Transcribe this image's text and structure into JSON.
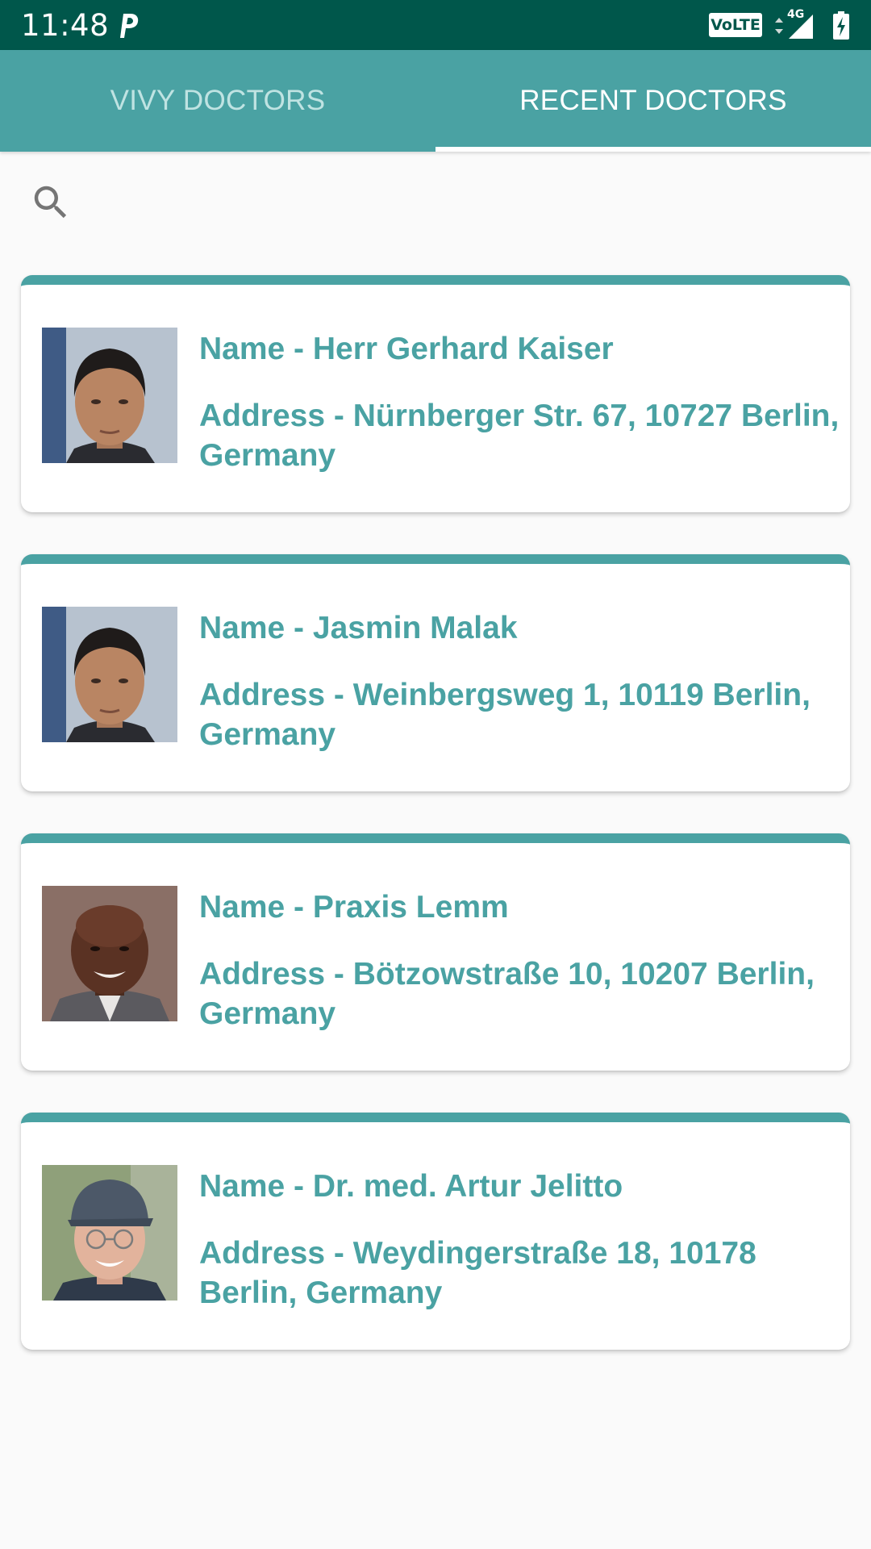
{
  "status_bar": {
    "time": "11:48",
    "volte": "VoLTE",
    "network": "4G",
    "icons": [
      "parking-app-icon",
      "signal-icon",
      "battery-charging-icon"
    ]
  },
  "tabs": [
    {
      "label": "VIVY DOCTORS",
      "selected": false
    },
    {
      "label": "RECENT DOCTORS",
      "selected": true
    }
  ],
  "search": {
    "icon": "search-icon"
  },
  "doctors": [
    {
      "name": "Name - Herr Gerhard Kaiser",
      "address": "Address - Nürnberger Str. 67, 10727 Berlin, Germany",
      "avatar": "man-dark-hair"
    },
    {
      "name": "Name - Jasmin Malak",
      "address": "Address - Weinbergsweg 1, 10119 Berlin, Germany",
      "avatar": "man-dark-hair"
    },
    {
      "name": "Name - Praxis Lemm",
      "address": "Address - Bötzowstraße 10, 10207 Berlin, Germany",
      "avatar": "man-bald-smiling"
    },
    {
      "name": "Name - Dr. med. Artur Jelitto",
      "address": "Address - Weydingerstraße 18, 10178 Berlin, Germany",
      "avatar": "man-cap-glasses"
    }
  ],
  "colors": {
    "status_bar": "#00574b",
    "primary": "#4aa2a3",
    "background": "#fafafa",
    "card": "#ffffff"
  }
}
